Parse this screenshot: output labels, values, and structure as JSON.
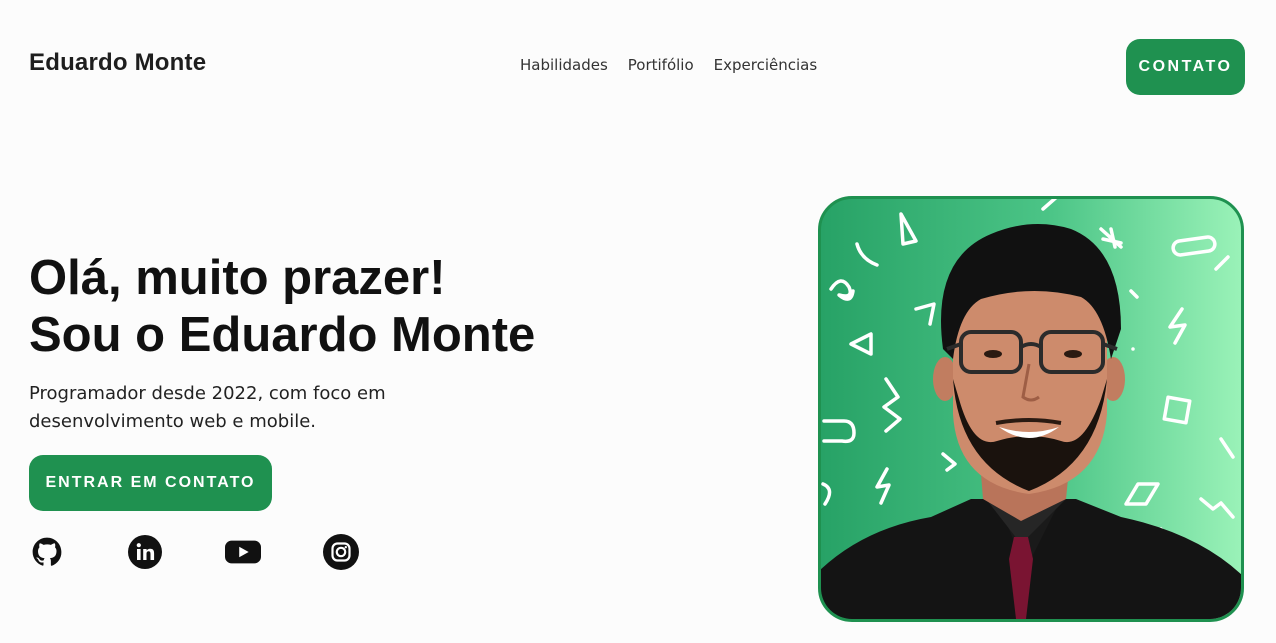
{
  "header": {
    "brand": "Eduardo Monte",
    "nav": [
      "Habilidades",
      "Portifólio",
      "Experciências"
    ],
    "contact_label": "CONTATO"
  },
  "hero": {
    "title_line1": "Olá, muito prazer!",
    "title_line2": "Sou o Eduardo Monte",
    "subtitle_line1": "Programador desde 2022, com foco em",
    "subtitle_line2": "desenvolvimento web e mobile.",
    "cta_label": "ENTRAR EM CONTATO"
  },
  "socials": [
    "github-icon",
    "linkedin-icon",
    "youtube-icon",
    "instagram-icon"
  ],
  "colors": {
    "accent": "#1f9150",
    "text": "#111111",
    "background": "#fcfcfc"
  }
}
